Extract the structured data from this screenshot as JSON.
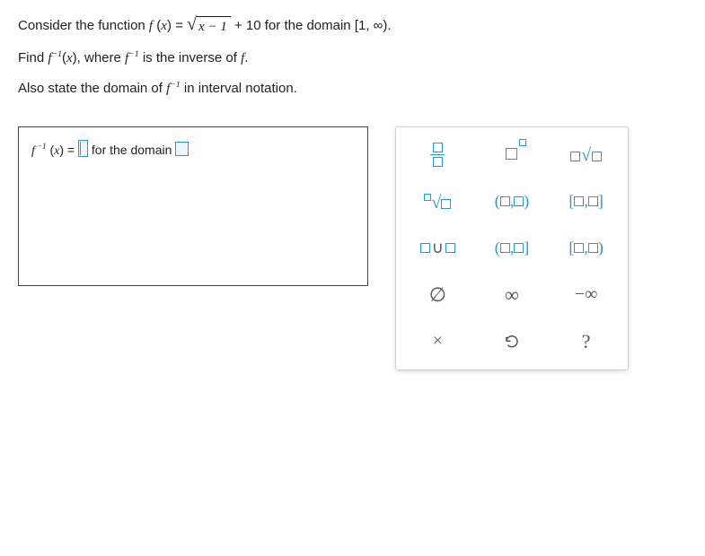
{
  "problem": {
    "line1_a": "Consider the function ",
    "func_f": "f",
    "func_arg": "x",
    "equals": " = ",
    "radicand": "x − 1",
    "plus_const": " + 10",
    "line1_b": " for the domain ",
    "domain_interval": "[1, ∞)",
    "period": ".",
    "line2_a": "Find ",
    "sup_minus1": "−1",
    "line2_b": ", where ",
    "line2_c": " is the inverse of ",
    "line3_a": "Also state the domain of ",
    "line3_b": " in interval notation."
  },
  "answer": {
    "equals": " = ",
    "for_the_domain": " for the domain "
  },
  "palette": {
    "fraction": {
      "name": "fraction"
    },
    "power": {
      "name": "power"
    },
    "coef_sqrt": {
      "name": "coef-sqrt"
    },
    "nth_root": {
      "name": "nth-root"
    },
    "open_open": "( , )",
    "closed_closed": "[ , ]",
    "union": "∪",
    "open_closed": "( , ]",
    "closed_open": "[ , )",
    "empty_set": "∅",
    "infinity": "∞",
    "neg_infinity": "−∞",
    "clear": "×",
    "reset": "↺",
    "help": "?"
  }
}
